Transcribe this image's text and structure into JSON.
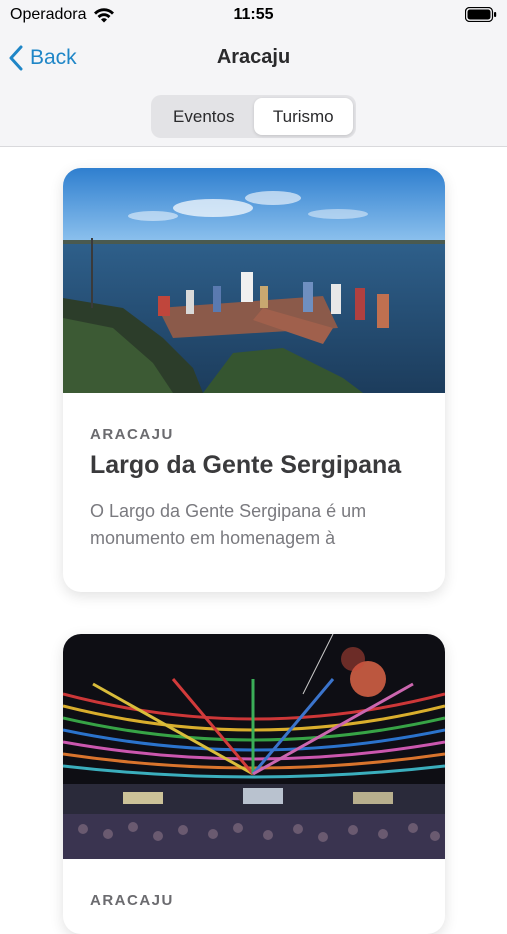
{
  "status_bar": {
    "carrier": "Operadora",
    "time": "11:55"
  },
  "nav": {
    "back_label": "Back",
    "title": "Aracaju"
  },
  "segmented_control": {
    "segments": [
      "Eventos",
      "Turismo"
    ],
    "selected": "Turismo"
  },
  "cards": [
    {
      "city": "ARACAJU",
      "title": "Largo da Gente Sergipana",
      "description": "O Largo da Gente Sergipana é um monumento em homenagem à"
    },
    {
      "city": "ARACAJU"
    }
  ],
  "colors": {
    "accent": "#1f86c7",
    "header_background": "#f5f5f7"
  }
}
